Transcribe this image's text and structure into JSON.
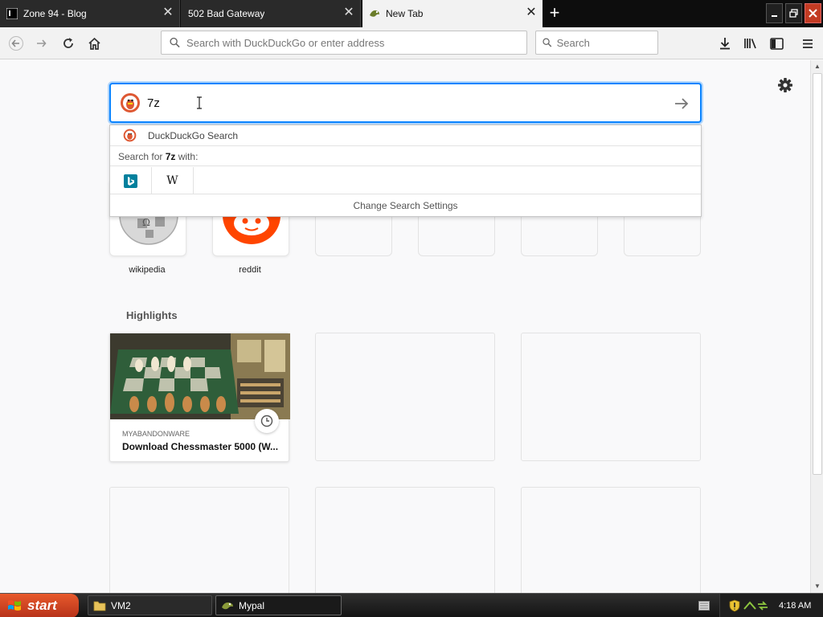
{
  "tabs": [
    {
      "title": "Zone 94 - Blog",
      "active": false
    },
    {
      "title": "502 Bad Gateway",
      "active": false
    },
    {
      "title": "New Tab",
      "active": true
    }
  ],
  "navbar": {
    "url_placeholder": "Search with DuckDuckGo or enter address",
    "search_placeholder": "Search"
  },
  "search": {
    "query": "7z",
    "suggestion_engine": "DuckDuckGo Search",
    "search_for_prefix": "Search for ",
    "search_for_suffix": " with:",
    "engines": [
      "bing",
      "wikipedia"
    ],
    "wikipedia_glyph": "W",
    "change_settings": "Change Search Settings"
  },
  "top_sites": [
    {
      "label": "wikipedia",
      "icon": "wikipedia-globe-icon"
    },
    {
      "label": "reddit",
      "icon": "reddit-alien-icon"
    }
  ],
  "highlights": {
    "title": "Highlights",
    "cards": [
      {
        "source": "MYABANDONWARE",
        "title": "Download Chessmaster 5000 (W..."
      }
    ]
  },
  "taskbar": {
    "start_label": "start",
    "items": [
      "VM2",
      "Mypal"
    ],
    "clock": "4:18 AM"
  },
  "colors": {
    "accent": "#0a84ff",
    "duckduckgo": "#de5833",
    "reddit": "#ff4500",
    "bing": "#00809d",
    "start_button": "#d9482a"
  }
}
